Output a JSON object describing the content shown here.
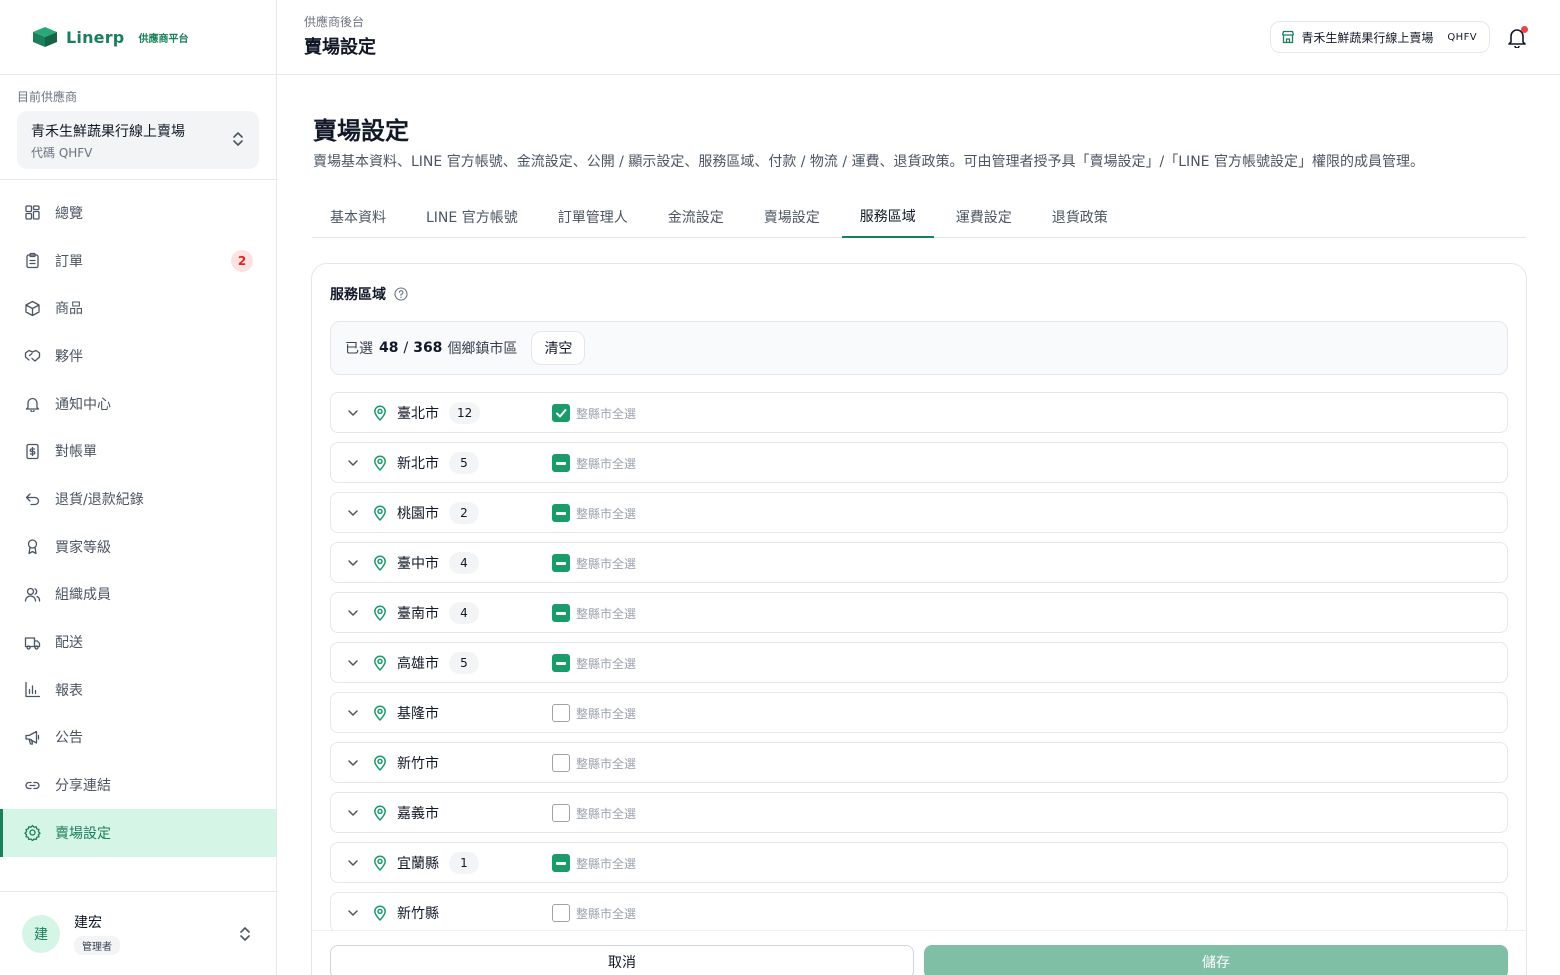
{
  "brand": {
    "name": "Linerp",
    "subtitle": "供應商平台"
  },
  "vendor": {
    "caption": "目前供應商",
    "name": "青禾生鮮蔬果行線上賣場",
    "code": "代碼 QHFV"
  },
  "nav": [
    {
      "label": "總覽",
      "icon": "grid-icon"
    },
    {
      "label": "訂單",
      "icon": "clipboard-icon",
      "badge": "2"
    },
    {
      "label": "商品",
      "icon": "package-icon"
    },
    {
      "label": "夥伴",
      "icon": "handshake-icon"
    },
    {
      "label": "通知中心",
      "icon": "bell-icon"
    },
    {
      "label": "對帳單",
      "icon": "invoice-icon"
    },
    {
      "label": "退貨/退款紀錄",
      "icon": "return-icon"
    },
    {
      "label": "買家等級",
      "icon": "award-icon"
    },
    {
      "label": "組織成員",
      "icon": "users-icon"
    },
    {
      "label": "配送",
      "icon": "truck-icon"
    },
    {
      "label": "報表",
      "icon": "chart-icon"
    },
    {
      "label": "公告",
      "icon": "megaphone-icon"
    },
    {
      "label": "分享連結",
      "icon": "link-icon"
    },
    {
      "label": "賣場設定",
      "icon": "gear-icon",
      "active": true
    }
  ],
  "user": {
    "initial": "建",
    "name": "建宏",
    "role": "管理者"
  },
  "header": {
    "breadcrumb": "供應商後台",
    "title": "賣場設定",
    "store_name": "青禾生鮮蔬果行線上賣場",
    "store_code": "QHFV"
  },
  "page": {
    "title": "賣場設定",
    "description": "賣場基本資料、LINE 官方帳號、金流設定、公開 / 顯示設定、服務區域、付款 / 物流 / 運費、退貨政策。可由管理者授予具「賣場設定」/「LINE 官方帳號設定」權限的成員管理。",
    "tabs": [
      "基本資料",
      "LINE 官方帳號",
      "訂單管理人",
      "金流設定",
      "賣場設定",
      "服務區域",
      "運費設定",
      "退貨政策"
    ],
    "active_tab": "服務區域"
  },
  "service_area": {
    "heading": "服務區域",
    "summary_prefix": "已選",
    "selected": "48",
    "total": "368",
    "summary_suffix": "個鄉鎮市區",
    "clear_label": "清空",
    "select_all_label": "整縣市全選",
    "cities": [
      {
        "name": "臺北市",
        "count": "12",
        "state": "checked"
      },
      {
        "name": "新北市",
        "count": "5",
        "state": "partial"
      },
      {
        "name": "桃園市",
        "count": "2",
        "state": "partial"
      },
      {
        "name": "臺中市",
        "count": "4",
        "state": "partial"
      },
      {
        "name": "臺南市",
        "count": "4",
        "state": "partial"
      },
      {
        "name": "高雄市",
        "count": "5",
        "state": "partial"
      },
      {
        "name": "基隆市",
        "count": "",
        "state": "unchecked"
      },
      {
        "name": "新竹市",
        "count": "",
        "state": "unchecked"
      },
      {
        "name": "嘉義市",
        "count": "",
        "state": "unchecked"
      },
      {
        "name": "宜蘭縣",
        "count": "1",
        "state": "partial"
      },
      {
        "name": "新竹縣",
        "count": "",
        "state": "unchecked"
      }
    ]
  },
  "actions": {
    "cancel_label": "取消",
    "save_label": "儲存"
  },
  "colors": {
    "accent": "#1a7f5a",
    "checkbox": "#1a9b6a",
    "active_nav_bg": "#d5f5e6",
    "save_disabled": "#7fbfa6",
    "badge_red": "#dc2626"
  }
}
